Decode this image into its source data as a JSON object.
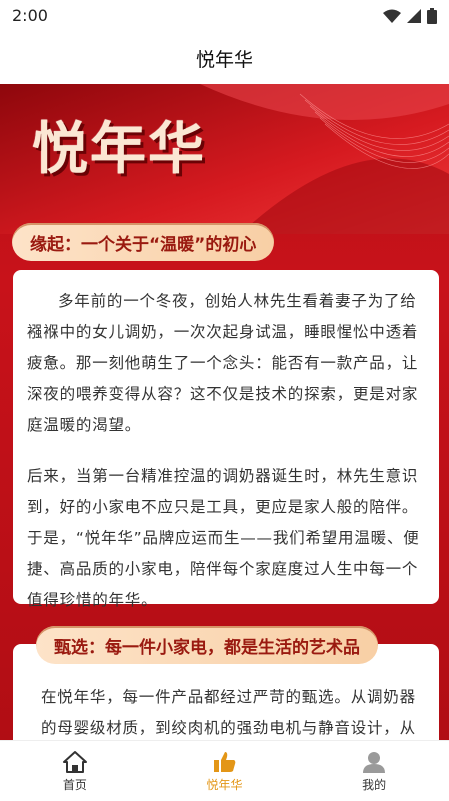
{
  "status": {
    "time": "2:00"
  },
  "header": {
    "title": "悦年华"
  },
  "hero": {
    "brand": "悦年华"
  },
  "section1": {
    "title": "缘起：一个关于“温暖”的初心",
    "para1": "多年前的一个冬夜，创始人林先生看着妻子为了给襁褓中的女儿调奶，一次次起身试温，睡眼惺忪中透着疲惫。那一刻他萌生了一个念头：能否有一款产品，让深夜的喂养变得从容？这不仅是技术的探索，更是对家庭温暖的渴望。",
    "para2": "后来，当第一台精准控温的调奶器诞生时，林先生意识到，好的小家电不应只是工具，更应是家人般的陪伴。于是，“悦年华”品牌应运而生——我们希望用温暖、便捷、高品质的小家电，陪伴每个家庭度过人生中每一个值得珍惜的年华。"
  },
  "section2": {
    "title": "甄选：每一件小家电，都是生活的艺术品",
    "para1": "在悦年华，每一件产品都经过严苛的甄选。从调奶器的母婴级材质，到绞肉机的强劲电机与静音设计，从养生壶的高硼硅玻璃，到取暖器的多重安全"
  },
  "tabs": [
    {
      "label": "首页",
      "icon": "home-icon"
    },
    {
      "label": "悦年华",
      "icon": "thumbs-up-icon"
    },
    {
      "label": "我的",
      "icon": "user-icon"
    }
  ],
  "colors": {
    "accent": "#e39617",
    "brand_red": "#c8121a"
  }
}
